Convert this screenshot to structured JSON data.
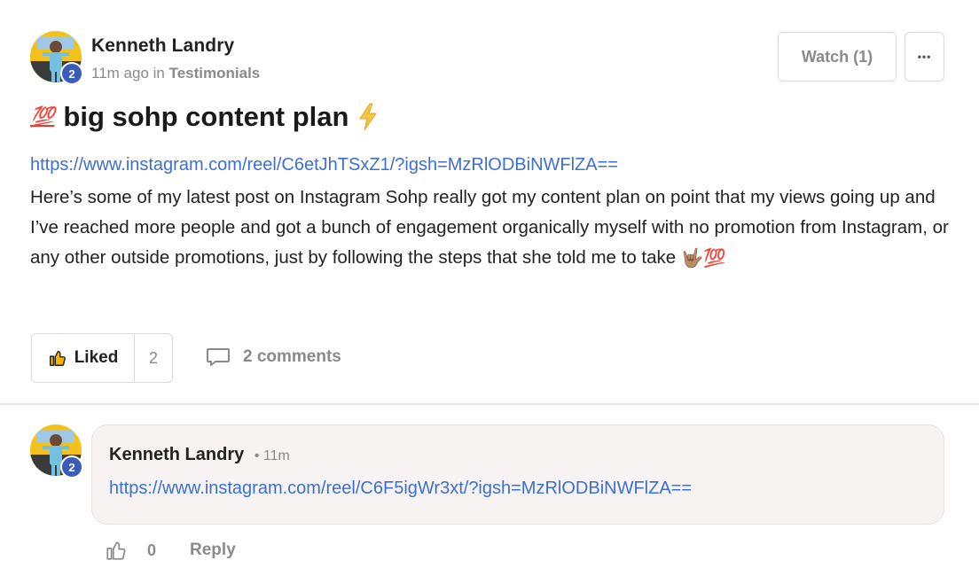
{
  "post": {
    "author": "Kenneth Landry",
    "level": "2",
    "time": "11m ago in",
    "category": "Testimonials",
    "watch_label": "Watch (1)",
    "more_label": "•••",
    "title_prefix_emoji": "💯",
    "title": "big sohp content plan",
    "title_suffix_emoji": "⚡",
    "link": "https://www.instagram.com/reel/C6etJhTSxZ1/?igsh=MzRlODBiNWFlZA==",
    "body": "Here’s some of my latest post on Instagram Sohp really got my content plan on point that my views going up and I’ve reached more people and got a bunch of engagement organically myself with no promotion from Instagram, or any other outside promotions, just by following the steps that she told me to take",
    "body_end_emoji": "🤟🏽💯",
    "liked_label": "Liked",
    "like_count": "2",
    "comments_label": "2 comments"
  },
  "comment": {
    "author": "Kenneth Landry",
    "level": "2",
    "time": "• 11m",
    "link": "https://www.instagram.com/reel/C6F5igWr3xt/?igsh=MzRlODBiNWFlZA==",
    "like_count": "0",
    "reply_label": "Reply"
  },
  "colors": {
    "link": "#3b6fd4",
    "level_badge": "#3b5bb8",
    "muted_text": "#8a8a8a"
  },
  "icons": [
    "level-badge",
    "ellipsis-icon",
    "bolt-icon",
    "thumbs-up-icon",
    "comment-bubble-icon"
  ]
}
